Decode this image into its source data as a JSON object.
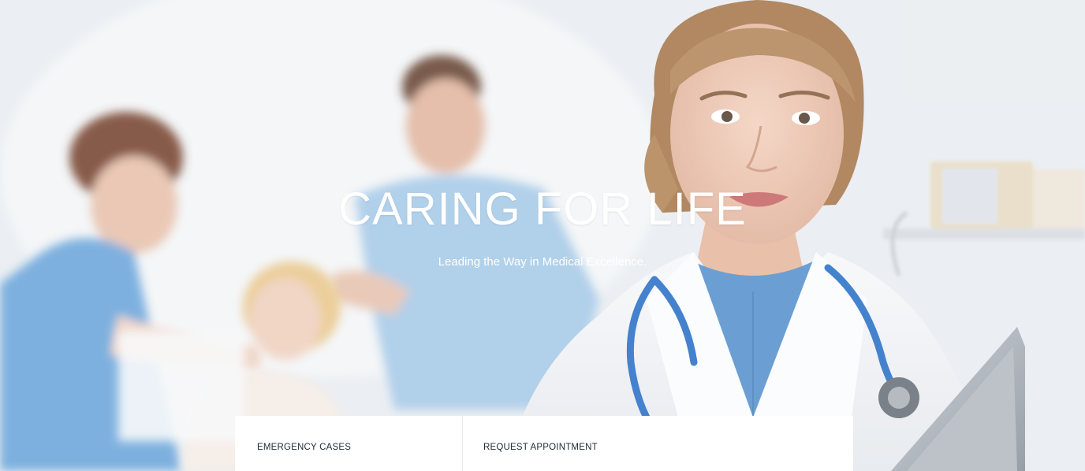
{
  "hero": {
    "title": "CARING FOR LIFE",
    "subtitle": "Leading the Way in Medical Excellence.",
    "image": "doctor-with-stethoscope-and-clipboard-photo"
  },
  "info_bar": {
    "emergency_label": "EMERGENCY CASES",
    "appointment_label": "REQUEST APPOINTMENT"
  },
  "colors": {
    "title_text": "#ffffff",
    "panel_background": "#ffffff",
    "panel_text": "#1f2a36",
    "scrub_blue": "#6fa8dc",
    "stethoscope_blue": "#2f74c9"
  }
}
